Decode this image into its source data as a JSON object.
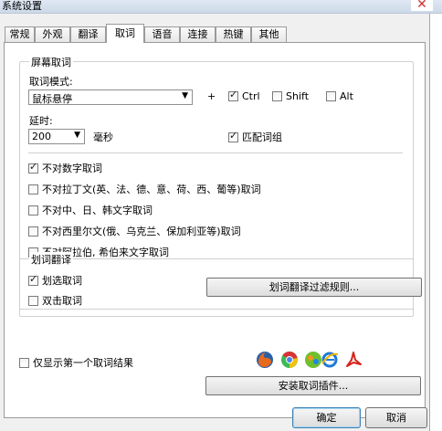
{
  "window": {
    "title": "系统设置",
    "close_glyph": "✕"
  },
  "tabs": [
    {
      "label": "常规",
      "active": false
    },
    {
      "label": "外观",
      "active": false
    },
    {
      "label": "翻译",
      "active": false
    },
    {
      "label": "取词",
      "active": true
    },
    {
      "label": "语音",
      "active": false
    },
    {
      "label": "连接",
      "active": false
    },
    {
      "label": "热键",
      "active": false
    },
    {
      "label": "其他",
      "active": false
    }
  ],
  "screen_capture": {
    "group_title": "屏幕取词",
    "mode_label": "取词模式:",
    "mode_value": "鼠标悬停",
    "plus": "+",
    "ctrl": {
      "label": "Ctrl",
      "checked": true
    },
    "shift": {
      "label": "Shift",
      "checked": false
    },
    "alt": {
      "label": "Alt",
      "checked": false
    },
    "delay_label": "延时:",
    "delay_value": "200",
    "delay_unit": "毫秒",
    "match_phrase": {
      "label": "匹配词组",
      "checked": true
    },
    "options": [
      {
        "label": "不对数字取词",
        "checked": true
      },
      {
        "label": "不对拉丁文(英、法、德、意、荷、西、葡等)取词",
        "checked": false
      },
      {
        "label": "不对中、日、韩文字取词",
        "checked": false
      },
      {
        "label": "不对西里尔文(俄、乌克兰、保加利亚等)取词",
        "checked": false
      },
      {
        "label": "不对阿拉伯, 希伯来文字取词",
        "checked": false
      }
    ]
  },
  "selection_translate": {
    "group_title": "划词翻译",
    "select_word": {
      "label": "划选取词",
      "checked": true
    },
    "double_click": {
      "label": "双击取词",
      "checked": false
    },
    "filter_button": "划词翻译过滤规则..."
  },
  "bottom": {
    "first_result": {
      "label": "仅显示第一个取词结果",
      "checked": false
    },
    "install_button": "安装取词插件...",
    "plugin_icons": [
      "firefox-icon",
      "chrome-icon",
      "ie-icon",
      "acrobat-icon"
    ]
  },
  "dialog_buttons": {
    "ok": "确定",
    "cancel": "取消"
  },
  "colors": {
    "firefox": "#e66a1e",
    "chrome_red": "#db3236",
    "chrome_yellow": "#f4c20d",
    "chrome_green": "#3cba54",
    "chrome_blue": "#4885ed",
    "ie_blue": "#1d7ad8",
    "acrobat": "#d4221c"
  }
}
